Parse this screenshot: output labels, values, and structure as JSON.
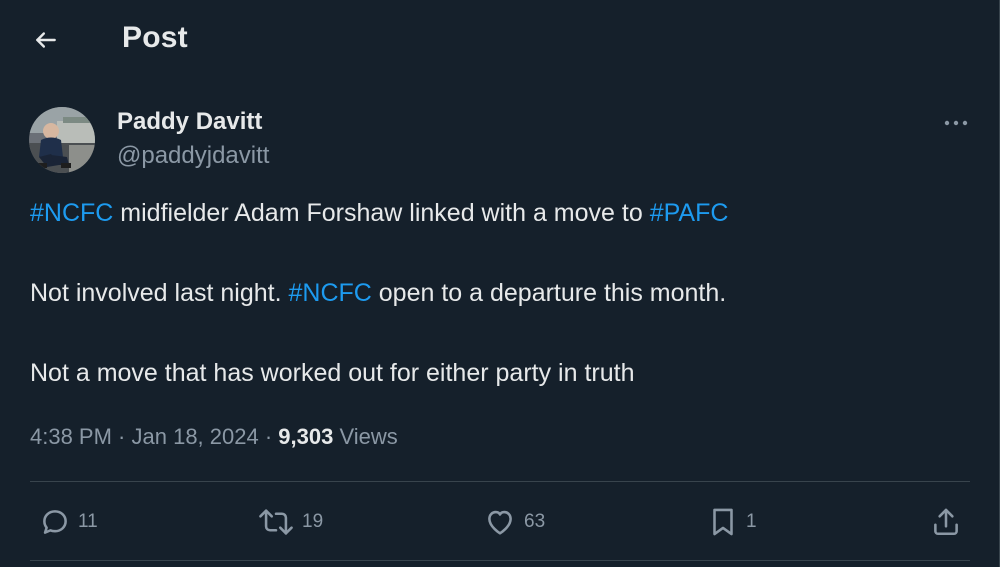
{
  "header": {
    "title": "Post",
    "back_icon": "arrow-left-icon"
  },
  "author": {
    "name": "Paddy Davitt",
    "handle": "@paddyjdavitt"
  },
  "tweet": {
    "line1": {
      "tag1": "#NCFC",
      "text1": " midfielder Adam Forshaw linked with a move to ",
      "tag2": "#PAFC"
    },
    "line2": {
      "text1": "Not involved last night. ",
      "tag1": "#NCFC",
      "text2": " open to a departure this month."
    },
    "line3": {
      "text1": "Not a move that has worked out for either party in truth"
    }
  },
  "meta": {
    "time": "4:38 PM",
    "sep1": " · ",
    "date": "Jan 18, 2024",
    "sep2": " · ",
    "views_count": "9,303",
    "views_label": " Views"
  },
  "actions": {
    "replies": "11",
    "reposts": "19",
    "likes": "63",
    "bookmarks": "1"
  },
  "colors": {
    "background": "#15202b",
    "text": "#e7e9ea",
    "secondary": "#8b98a5",
    "accent": "#1d9bf0",
    "border": "#38444d"
  }
}
